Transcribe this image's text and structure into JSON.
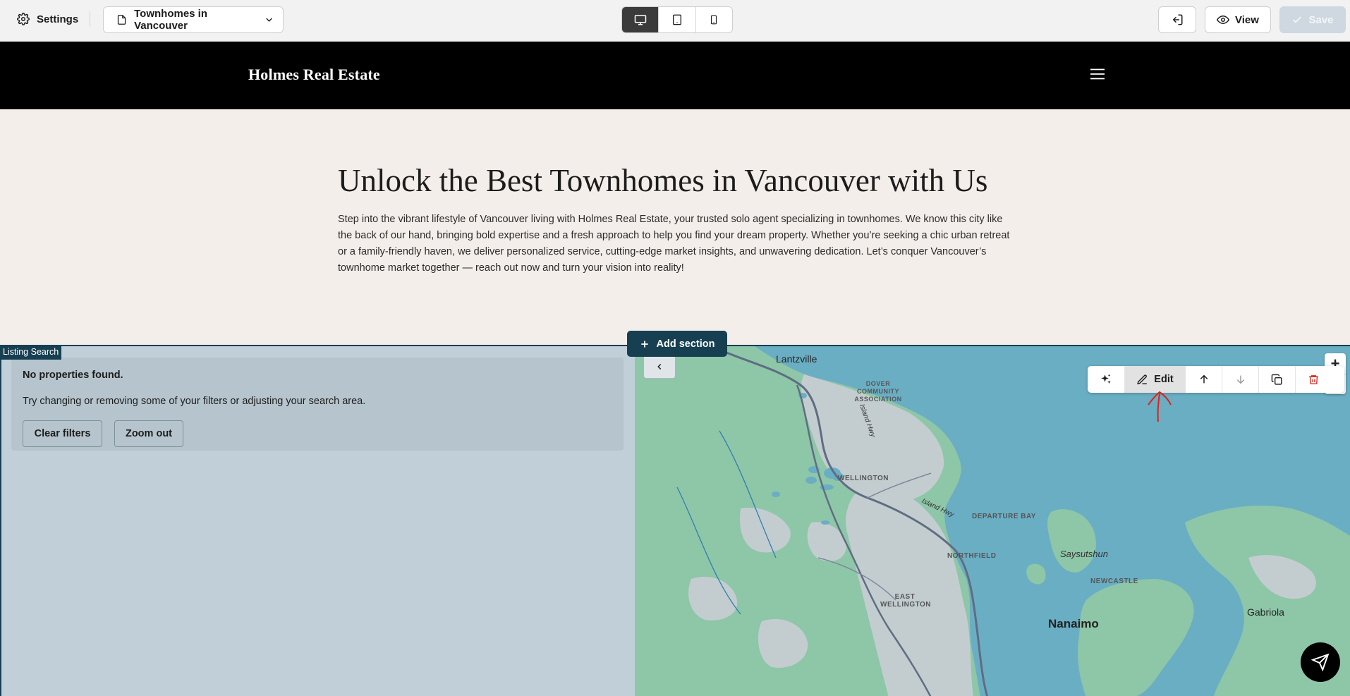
{
  "topbar": {
    "settings_label": "Settings",
    "page_name": "Townhomes in Vancouver",
    "devices": [
      "desktop",
      "tablet",
      "mobile"
    ],
    "active_device": "desktop",
    "view_label": "View",
    "save_label": "Save"
  },
  "site": {
    "brand": "Holmes Real Estate"
  },
  "hero": {
    "title": "Unlock the Best Townhomes in Vancouver with Us",
    "body": "Step into the vibrant lifestyle of Vancouver living with Holmes Real Estate, your trusted solo agent specializing in townhomes. We know this city like the back of our hand, bringing bold expertise and a fresh approach to help you find your dream property. Whether you’re seeking a chic urban retreat or a family-friendly haven, we deliver personalized service, cutting-edge market insights, and unwavering dedication. Let’s conquer Vancouver’s townhome market together — reach out now and turn your vision into reality!"
  },
  "editor": {
    "add_section_label": "Add section",
    "section_tag": "Listing Search",
    "edit_label": "Edit"
  },
  "listing": {
    "empty_title": "No properties found.",
    "empty_message": "Try changing or removing some of your filters or adjusting your search area.",
    "clear_filters_label": "Clear filters",
    "zoom_out_label": "Zoom out"
  },
  "map": {
    "zoom_in": "+",
    "zoom_out": "−",
    "labels": {
      "lantzville": "Lantzville",
      "dover": "DOVER COMMUNITY ASSOCIATION",
      "island_hwy_1": "Island Hwy",
      "wellington": "WELLINGTON",
      "island_hwy_2": "Island Hwy",
      "departure_bay": "DEPARTURE BAY",
      "saysutshun": "Saysutshun",
      "northfield": "NORTHFIELD",
      "newcastle": "NEWCASTLE",
      "east_wellington": "EAST WELLINGTON",
      "nanaimo": "Nanaimo",
      "gabriola": "Gabriola"
    },
    "colors": {
      "water": "#6aaec4",
      "land": "#8ec6a8",
      "urban": "#c3cdd0",
      "road": "#5f6d82"
    }
  },
  "colors": {
    "accent": "#173f52",
    "hero_bg": "#f3eee9",
    "listing_bg": "#c1d0d8",
    "delete": "#d93025"
  }
}
